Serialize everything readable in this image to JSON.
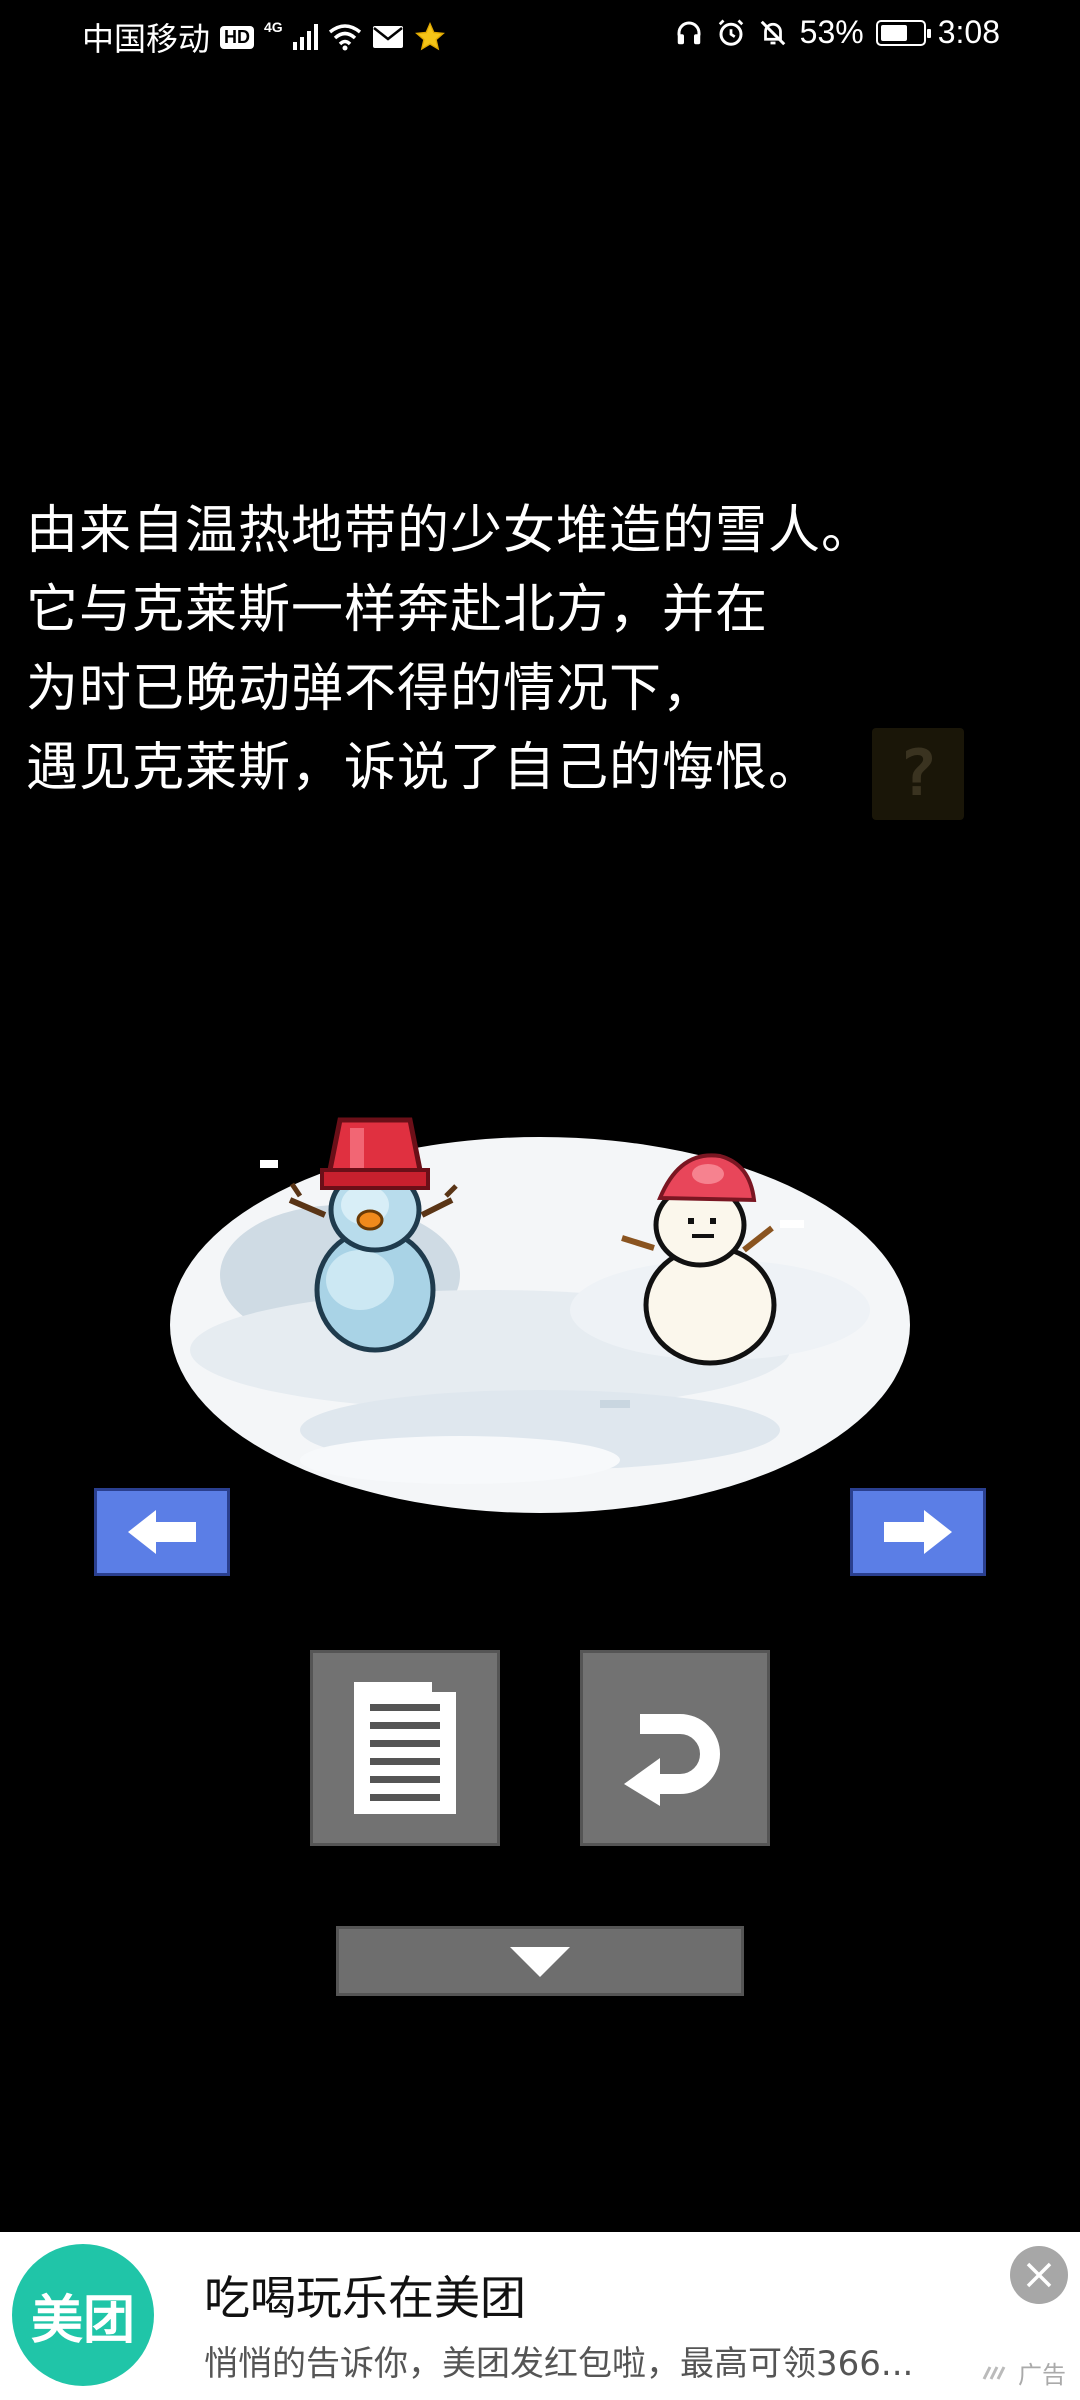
{
  "status_bar": {
    "carrier": "中国移动",
    "hd": "HD",
    "network": "4G",
    "battery": "53%",
    "time": "3:08"
  },
  "story": {
    "lines": [
      "由来自温热地带的少女堆造的雪人。",
      "它与克莱斯一样奔赴北方，并在",
      "为时已晚动弹不得的情况下，",
      "遇见克莱斯，诉说了自己的悔恨。"
    ],
    "hint": "?"
  },
  "controls": {
    "prev_icon": "arrow-left-icon",
    "next_icon": "arrow-right-icon",
    "log_icon": "document-icon",
    "retry_icon": "undo-icon",
    "down_icon": "chevron-down-icon"
  },
  "ad": {
    "logo_text": "美团",
    "title": "吃喝玩乐在美团",
    "description": "悄悄的告诉你，美团发红包啦，最高可领366...",
    "tag": "广告"
  },
  "colors": {
    "arrow_button": "#5b7ee6",
    "gray_button": "#727272",
    "ad_logo": "#20c5a8",
    "background": "#000000"
  }
}
